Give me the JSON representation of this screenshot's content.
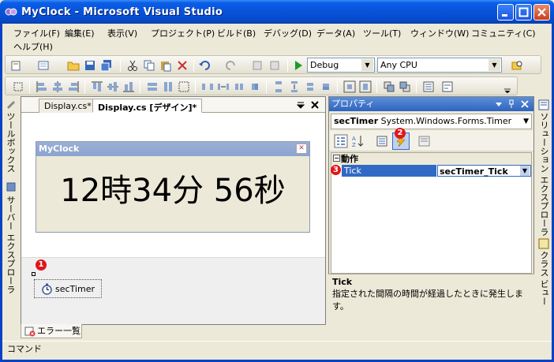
{
  "window": {
    "title": "MyClock - Microsoft Visual Studio",
    "minimize_label": "Minimize",
    "maximize_label": "Maximize",
    "close_label": "Close"
  },
  "menu": {
    "items": [
      {
        "label": "ファイル(F)"
      },
      {
        "label": "編集(E)"
      },
      {
        "label": "表示(V)"
      },
      {
        "label": "プロジェクト(P)"
      },
      {
        "label": "ビルド(B)"
      },
      {
        "label": "デバッグ(D)"
      },
      {
        "label": "データ(A)"
      },
      {
        "label": "ツール(T)"
      },
      {
        "label": "ウィンドウ(W)"
      },
      {
        "label": "コミュニティ(C)"
      },
      {
        "label": "ヘルプ(H)"
      }
    ]
  },
  "toolbar": {
    "config_value": "Debug",
    "platform_value": "Any CPU"
  },
  "left_sidebar": {
    "toolbox_label": "ツールボックス",
    "server_explorer_label": "サーバー エクスプローラ"
  },
  "right_sidebar": {
    "solution_explorer_label": "ソリューション エクスプローラ",
    "class_view_label": "クラス ビュー"
  },
  "document": {
    "tabs": [
      {
        "label": "Display.cs*"
      },
      {
        "label": "Display.cs [デザイン]*"
      }
    ],
    "form_title": "MyClock",
    "clock_text": "12時34分 56秒",
    "timer_component": "secTimer"
  },
  "properties": {
    "title": "プロパティ",
    "object_name": "secTimer",
    "object_type": "System.Windows.Forms.Timer",
    "category": "動作",
    "property_name": "Tick",
    "property_value": "secTimer_Tick",
    "description_title": "Tick",
    "description_text": "指定された間隔の時間が経過したときに発生します。"
  },
  "markers": {
    "m1": "1",
    "m2": "2",
    "m3": "3"
  },
  "bottom": {
    "error_list_label": "エラー一覧",
    "command_label": "コマンド"
  },
  "colors": {
    "titlebar": "#0753D8",
    "selection": "#316AC5",
    "marker": "#E2151B"
  }
}
